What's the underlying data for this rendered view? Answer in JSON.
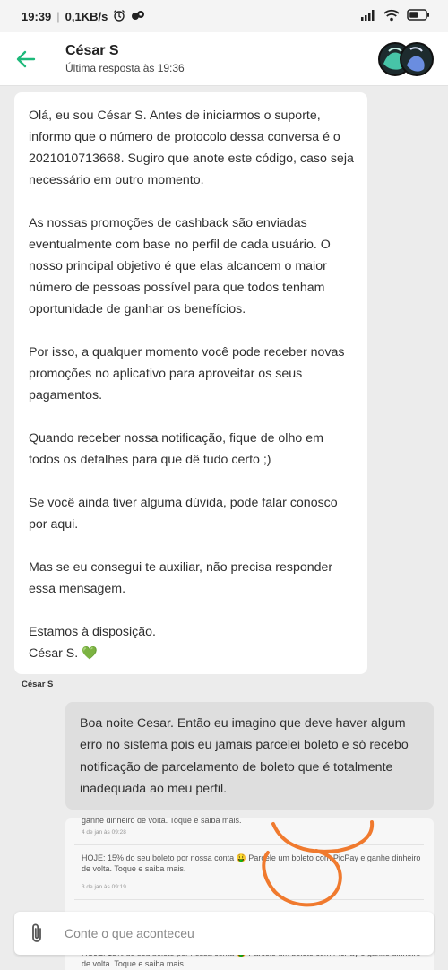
{
  "status_bar": {
    "time": "19:39",
    "speed": "0,1KB/s"
  },
  "header": {
    "contact_name": "César S",
    "last_seen": "Última resposta às 19:36"
  },
  "messages": {
    "incoming": {
      "paragraphs": [
        "Olá, eu sou César S. Antes de iniciarmos o suporte, informo que o número de protocolo dessa conversa é o 2021010713668. Sugiro que anote este código, caso seja necessário em outro momento.",
        "As nossas promoções de cashback são enviadas eventualmente com base no perfil de cada usuário. O nosso principal objetivo é que elas alcancem o maior número de pessoas possível para que todos tenham oportunidade de ganhar os benefícios.",
        "Por isso, a qualquer momento você pode receber novas promoções no aplicativo para aproveitar os seus pagamentos.",
        "Quando receber nossa notificação, fique de olho em todos os detalhes para que dê tudo certo ;)",
        "Se você ainda tiver alguma dúvida, pode falar conosco por aqui.",
        "Mas se eu consegui te auxiliar, não precisa responder essa mensagem."
      ],
      "closing": "Estamos à disposição.",
      "signature": "César S.",
      "signature_emoji": "💚",
      "sender": "César S"
    },
    "outgoing": {
      "text": "Boa noite Cesar. Então eu imagino que deve haver algum erro no sistema pois eu jamais parcelei boleto e só recebo notificação de parcelamento de boleto que é totalmente inadequada ao meu perfil."
    },
    "attachment": {
      "notifications": [
        {
          "text": "ganhe dinheiro de volta. Toque e saiba mais.",
          "date": "4 de jan às 09:28"
        },
        {
          "text": "HOJE: 15% do seu boleto por nossa conta 🤑 Parcele um boleto com PicPay e ganhe dinheiro de volta. Toque e saiba mais.",
          "date": "3 de jan às 09:19"
        },
        {
          "text": "HOJE: 15% do seu boleto por nossa conta 🤑 Parcele um boleto com PicPay e ganhe dinheiro de volta. Toque e saiba mais.",
          "date": ""
        }
      ],
      "scribble_color": "#f07a2e"
    }
  },
  "composer": {
    "placeholder": "Conte o que aconteceu"
  },
  "colors": {
    "accent": "#1db97a",
    "heart": "#59b848"
  }
}
